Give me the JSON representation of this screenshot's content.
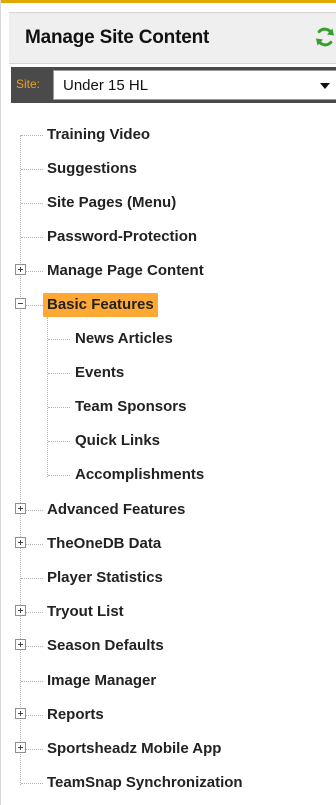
{
  "header": {
    "title": "Manage Site Content",
    "refresh_icon": "refresh-icon"
  },
  "site": {
    "label": "Site:",
    "selected": "Under 15 HL"
  },
  "tree": [
    {
      "label": "Training Video",
      "expandable": false
    },
    {
      "label": "Suggestions",
      "expandable": false
    },
    {
      "label": "Site Pages (Menu)",
      "expandable": false
    },
    {
      "label": "Password-Protection",
      "expandable": false
    },
    {
      "label": "Manage Page Content",
      "expandable": true,
      "expanded": false
    },
    {
      "label": "Basic Features",
      "expandable": true,
      "expanded": true,
      "selected": true,
      "children": [
        {
          "label": "News Articles"
        },
        {
          "label": "Events"
        },
        {
          "label": "Team Sponsors"
        },
        {
          "label": "Quick Links"
        },
        {
          "label": "Accomplishments"
        }
      ]
    },
    {
      "label": "Advanced Features",
      "expandable": true,
      "expanded": false
    },
    {
      "label": "TheOneDB Data",
      "expandable": true,
      "expanded": false
    },
    {
      "label": "Player Statistics",
      "expandable": false
    },
    {
      "label": "Tryout List",
      "expandable": true,
      "expanded": false
    },
    {
      "label": "Season Defaults",
      "expandable": true,
      "expanded": false
    },
    {
      "label": "Image Manager",
      "expandable": false
    },
    {
      "label": "Reports",
      "expandable": true,
      "expanded": false
    },
    {
      "label": "Sportsheadz Mobile App",
      "expandable": true,
      "expanded": false
    },
    {
      "label": "TeamSnap Synchronization",
      "expandable": false
    }
  ],
  "colors": {
    "selected_bg": "#ffa834",
    "site_bar": "#4a4a4a",
    "site_label": "#f0a020",
    "refresh_green": "#33a02c"
  }
}
